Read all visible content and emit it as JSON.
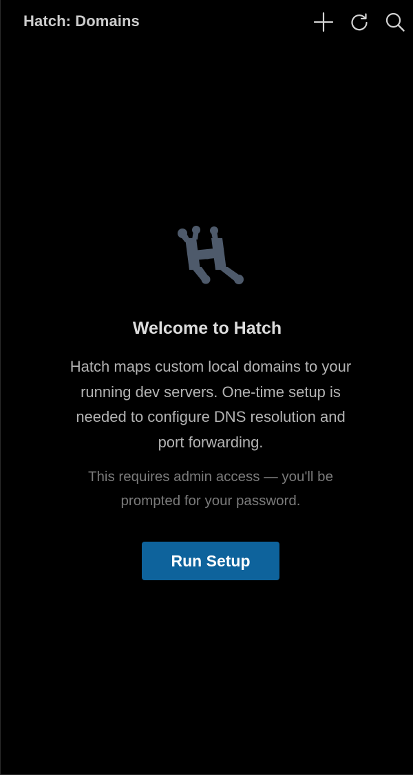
{
  "header": {
    "title": "Hatch: Domains",
    "actions": [
      {
        "name": "add",
        "icon": "plus-icon"
      },
      {
        "name": "refresh",
        "icon": "refresh-icon"
      },
      {
        "name": "search",
        "icon": "search-icon"
      }
    ]
  },
  "welcome": {
    "logo_icon": "hatch-logo-icon",
    "heading": "Welcome to Hatch",
    "description": "Hatch maps custom local domains to your running dev servers. One-time setup is needed to configure DNS resolution and port forwarding.",
    "note": "This requires admin access — you'll be prompted for your password.",
    "button_label": "Run Setup"
  },
  "colors": {
    "background": "#000000",
    "primary_button": "#0e639c",
    "logo": "#4e5a6b",
    "text_primary": "#dcdcdc",
    "text_secondary": "#b3b3b3",
    "text_muted": "#7a7a7a"
  }
}
